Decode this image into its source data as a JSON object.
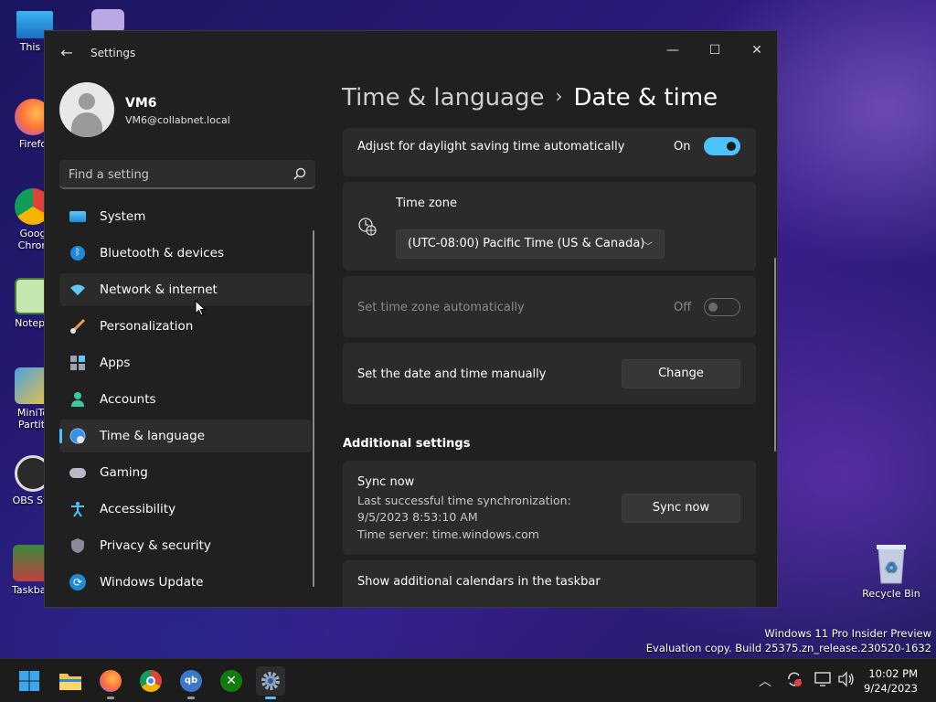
{
  "desktop": {
    "icons": [
      {
        "label": "This P"
      },
      {
        "label": "Firefo"
      },
      {
        "label": "Goog\nChron"
      },
      {
        "label": "Notepa"
      },
      {
        "label": "MiniTo\nPartiti"
      },
      {
        "label": "OBS Stu"
      },
      {
        "label": "Taskbar"
      }
    ],
    "recycle_bin": "Recycle Bin",
    "watermark": {
      "line1": "Windows 11 Pro Insider Preview",
      "line2": "Evaluation copy. Build 25375.zn_release.230520-1632"
    }
  },
  "window": {
    "title": "Settings",
    "user": {
      "name": "VM6",
      "email": "VM6@collabnet.local"
    },
    "search": {
      "placeholder": "Find a setting"
    },
    "nav": [
      {
        "label": "System",
        "icon": "system-icon"
      },
      {
        "label": "Bluetooth & devices",
        "icon": "bluetooth-icon"
      },
      {
        "label": "Network & internet",
        "icon": "network-icon"
      },
      {
        "label": "Personalization",
        "icon": "brush-icon"
      },
      {
        "label": "Apps",
        "icon": "apps-icon"
      },
      {
        "label": "Accounts",
        "icon": "accounts-icon"
      },
      {
        "label": "Time & language",
        "icon": "time-language-icon"
      },
      {
        "label": "Gaming",
        "icon": "gaming-icon"
      },
      {
        "label": "Accessibility",
        "icon": "accessibility-icon"
      },
      {
        "label": "Privacy & security",
        "icon": "shield-icon"
      },
      {
        "label": "Windows Update",
        "icon": "update-icon"
      }
    ],
    "breadcrumb": {
      "parent": "Time & language",
      "separator": "›",
      "current": "Date & time"
    },
    "settings": {
      "daylight": {
        "label": "Adjust for daylight saving time automatically",
        "state": "On"
      },
      "timezone": {
        "label": "Time zone",
        "value": "(UTC-08:00) Pacific Time (US & Canada)"
      },
      "auto_timezone": {
        "label": "Set time zone automatically",
        "state": "Off"
      },
      "manual": {
        "label": "Set the date and time manually",
        "button": "Change"
      },
      "additional_title": "Additional settings",
      "sync": {
        "label": "Sync now",
        "last_sync_label": "Last successful time synchronization:",
        "last_sync_value": "9/5/2023 8:53:10 AM",
        "server": "Time server: time.windows.com",
        "button": "Sync now"
      },
      "calendars": {
        "label": "Show additional calendars in the taskbar"
      }
    }
  },
  "taskbar": {
    "clock": {
      "time": "10:02 PM",
      "date": "9/24/2023"
    }
  },
  "colors": {
    "accent": "#4cc2ff",
    "window_bg": "#202020",
    "card_bg": "#2b2b2b"
  }
}
